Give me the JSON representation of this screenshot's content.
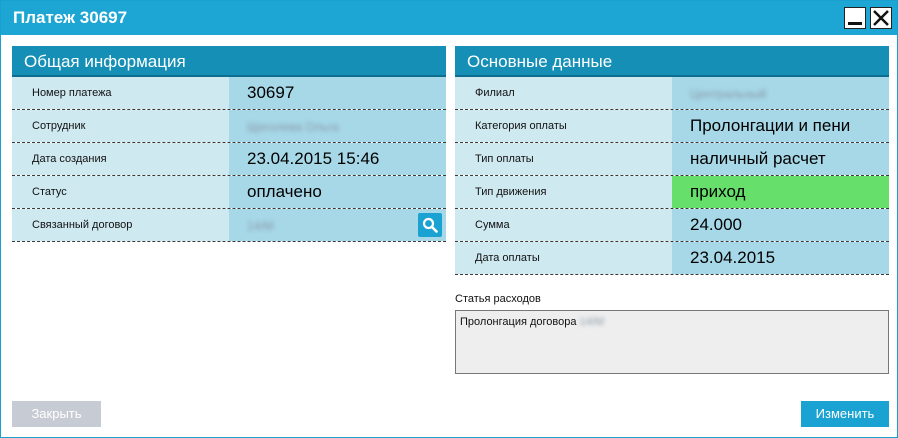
{
  "window": {
    "title": "Платеж 30697"
  },
  "general": {
    "header": "Общая информация",
    "rows": [
      {
        "label": "Номер платежа",
        "value": "30697"
      },
      {
        "label": "Сотрудник",
        "value": "Щеголева Ольга"
      },
      {
        "label": "Дата создания",
        "value": "23.04.2015 15:46"
      },
      {
        "label": "Статус",
        "value": "оплачено"
      },
      {
        "label": "Связанный договор",
        "value": "14/М"
      }
    ]
  },
  "main": {
    "header": "Основные данные",
    "rows": [
      {
        "label": "Филиал",
        "value": "Центральный"
      },
      {
        "label": "Категория оплаты",
        "value": "Пролонгации и пени"
      },
      {
        "label": "Тип оплаты",
        "value": "наличный расчет"
      },
      {
        "label": "Тип движения",
        "value": "приход"
      },
      {
        "label": "Сумма",
        "value": "24.000"
      },
      {
        "label": "Дата оплаты",
        "value": "23.04.2015"
      }
    ]
  },
  "expense": {
    "label": "Статья расходов",
    "text": "Пролонгация договора",
    "blurred_suffix": "14/М"
  },
  "buttons": {
    "close": "Закрыть",
    "edit": "Изменить"
  },
  "colors": {
    "titlebar": "#1da6d4",
    "header": "#168fb7",
    "label_bg": "#cfe9f1",
    "value_bg": "#a6d8e8",
    "highlight": "#66e06a"
  }
}
